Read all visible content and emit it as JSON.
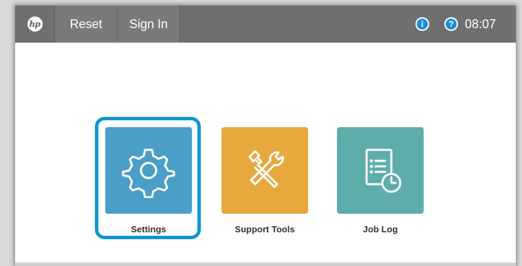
{
  "topbar": {
    "logo_text": "hp",
    "reset_label": "Reset",
    "signin_label": "Sign In",
    "info_glyph": "i",
    "help_glyph": "?",
    "time": "08:07"
  },
  "apps": [
    {
      "label": "Settings",
      "icon": "gear-icon",
      "color": "#4a9ec7",
      "selected": true
    },
    {
      "label": "Support Tools",
      "icon": "wrench-screwdriver-icon",
      "color": "#e7a93d",
      "selected": false
    },
    {
      "label": "Job Log",
      "icon": "document-clock-icon",
      "color": "#5eadaa",
      "selected": false
    }
  ],
  "colors": {
    "topbar": "#6f6f6f",
    "selection": "#0d96d6",
    "info_help": "#1a8fd9"
  }
}
